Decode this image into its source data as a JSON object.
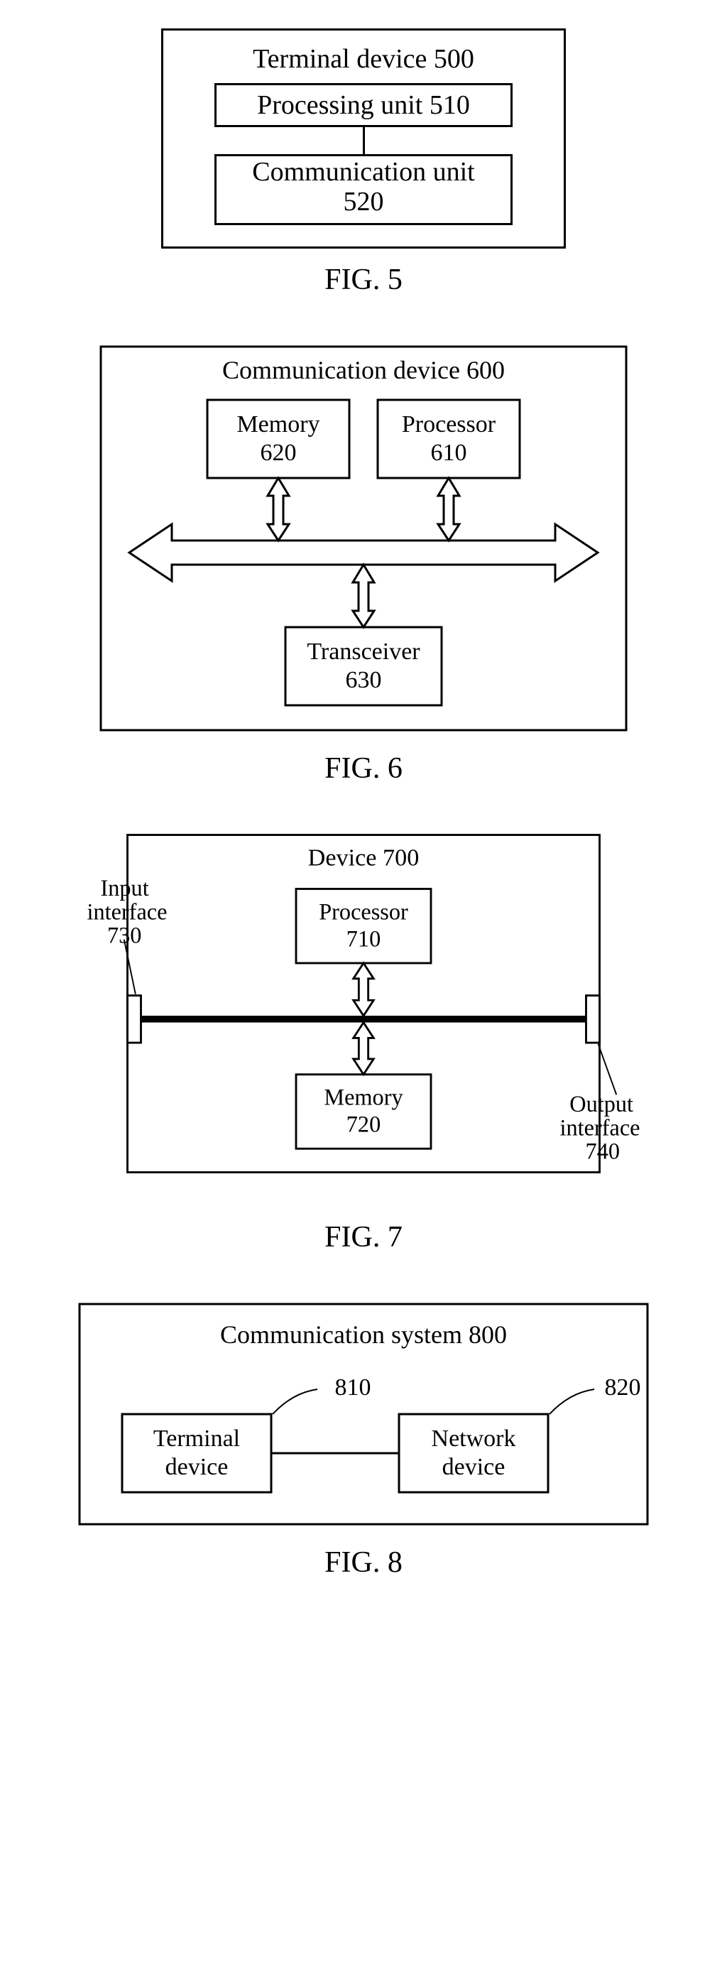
{
  "fig5": {
    "caption": "FIG. 5",
    "outer_title": "Terminal device 500",
    "box1": "Processing unit 510",
    "box2_line1": "Communication unit",
    "box2_line2": "520"
  },
  "fig6": {
    "caption": "FIG. 6",
    "outer_title": "Communication device 600",
    "memory_l1": "Memory",
    "memory_l2": "620",
    "processor_l1": "Processor",
    "processor_l2": "610",
    "transceiver_l1": "Transceiver",
    "transceiver_l2": "630"
  },
  "fig7": {
    "caption": "FIG. 7",
    "outer_title": "Device 700",
    "input_l1": "Input",
    "input_l2": "interface",
    "input_l3": "730",
    "processor_l1": "Processor",
    "processor_l2": "710",
    "memory_l1": "Memory",
    "memory_l2": "720",
    "output_l1": "Output",
    "output_l2": "interface",
    "output_l3": "740"
  },
  "fig8": {
    "caption": "FIG. 8",
    "outer_title": "Communication system 800",
    "terminal_l1": "Terminal",
    "terminal_l2": "device",
    "terminal_num": "810",
    "network_l1": "Network",
    "network_l2": "device",
    "network_num": "820"
  }
}
